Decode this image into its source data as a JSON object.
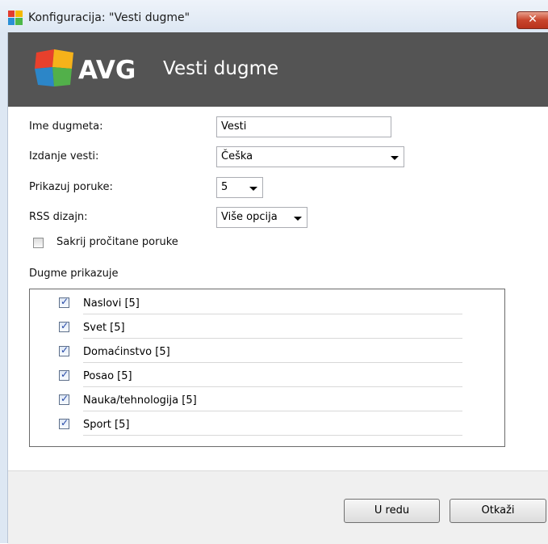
{
  "window": {
    "title": "Konfiguracija: \"Vesti dugme\"",
    "close_glyph": "✕"
  },
  "header": {
    "brand": "AVG",
    "title": "Vesti dugme"
  },
  "form": {
    "button_name_label": "Ime dugmeta:",
    "button_name_value": "Vesti",
    "edition_label": "Izdanje vesti:",
    "edition_value": "Češka",
    "show_messages_label": "Prikazuj poruke:",
    "show_messages_value": "5",
    "rss_design_label": "RSS dizajn:",
    "rss_design_value": "Više opcija",
    "hide_read_label": "Sakrij pročitane poruke",
    "hide_read_checked": false
  },
  "group": {
    "label": "Dugme prikazuje",
    "items": [
      {
        "label": "Naslovi [5]",
        "checked": true
      },
      {
        "label": "Svet [5]",
        "checked": true
      },
      {
        "label": "Domaćinstvo [5]",
        "checked": true
      },
      {
        "label": "Posao [5]",
        "checked": true
      },
      {
        "label": "Nauka/tehnologija [5]",
        "checked": true
      },
      {
        "label": "Sport [5]",
        "checked": true
      }
    ]
  },
  "buttons": {
    "ok": "U redu",
    "cancel": "Otkaži"
  },
  "icons": {
    "app": "avg-logo-icon",
    "close": "close-icon",
    "dropdown": "chevron-down-icon",
    "check": "checkmark-icon"
  },
  "colors": {
    "header_bg": "#545454",
    "close_red": "#c8442c",
    "check_blue": "#2447a6"
  }
}
